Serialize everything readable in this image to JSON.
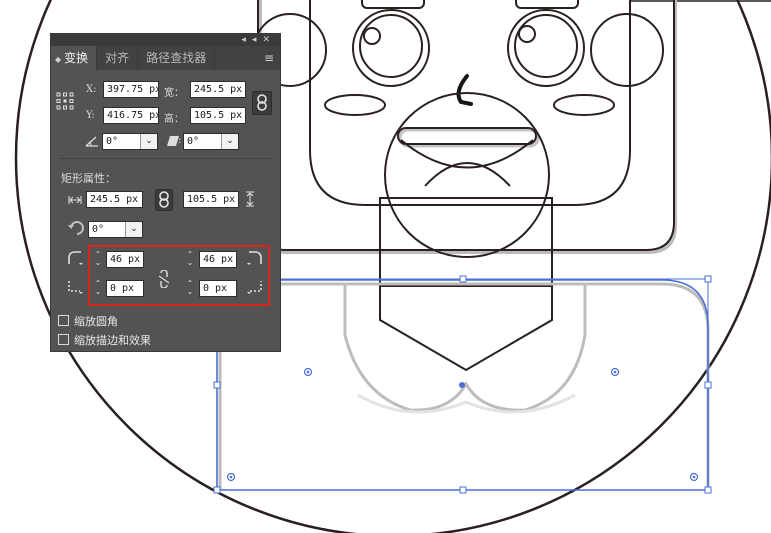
{
  "panel": {
    "tabs": [
      {
        "label": "变换",
        "active": true
      },
      {
        "label": "对齐",
        "active": false
      },
      {
        "label": "路径查找器",
        "active": false
      }
    ],
    "titlebar_icons": [
      "collapse-icon",
      "close-icon"
    ],
    "menu_icon": "hamburger-menu-icon",
    "transform": {
      "x_label": "X:",
      "x_value": "397.75 px",
      "width_label": "宽：",
      "width_value": "245.5 px",
      "y_label": "Y:",
      "y_value": "416.75 px",
      "height_label": "高：",
      "height_value": "105.5 px",
      "angle_value": "0°",
      "shear_value": "0°"
    },
    "rect_props": {
      "title": "矩形属性：",
      "width_value": "245.5 px",
      "height_value": "105.5 px",
      "rotate_value": "0°",
      "corner_tl": "46 px",
      "corner_tr": "46 px",
      "corner_bl": "0 px",
      "corner_br": "0 px"
    },
    "options": [
      {
        "label": "缩放圆角",
        "checked": false
      },
      {
        "label": "缩放描边和效果",
        "checked": false
      }
    ]
  },
  "colors": {
    "panel_bg": "#535353",
    "selection": "#4a6fd6",
    "highlight": "#d9241c",
    "artwork_stroke": "#2a2020"
  }
}
